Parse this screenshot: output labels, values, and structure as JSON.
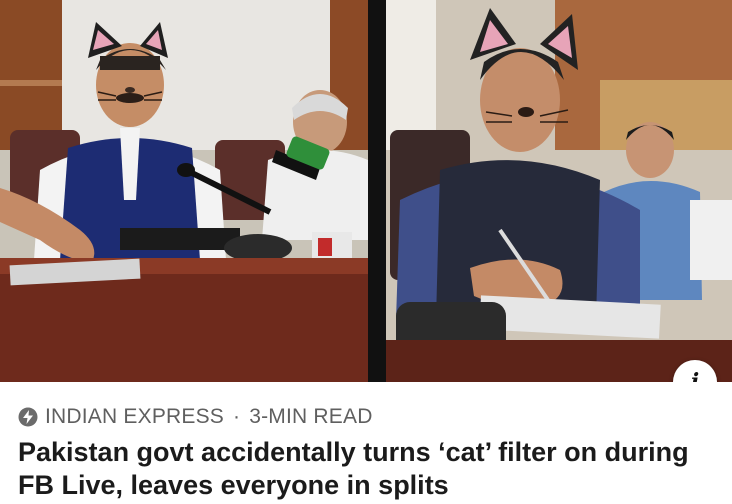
{
  "article": {
    "source": "INDIAN EXPRESS",
    "separator": "·",
    "read_time": "3-MIN READ",
    "headline": "Pakistan govt accidentally turns ‘cat’ filter on during FB Live, leaves everyone in splits"
  },
  "image": {
    "description_icon": "info-icon",
    "info_label": "i"
  },
  "icons": {
    "source_icon": "bolt-circle-icon"
  },
  "colors": {
    "headline": "#1b1b1b",
    "meta": "#5f5f5f",
    "background": "#ffffff"
  }
}
